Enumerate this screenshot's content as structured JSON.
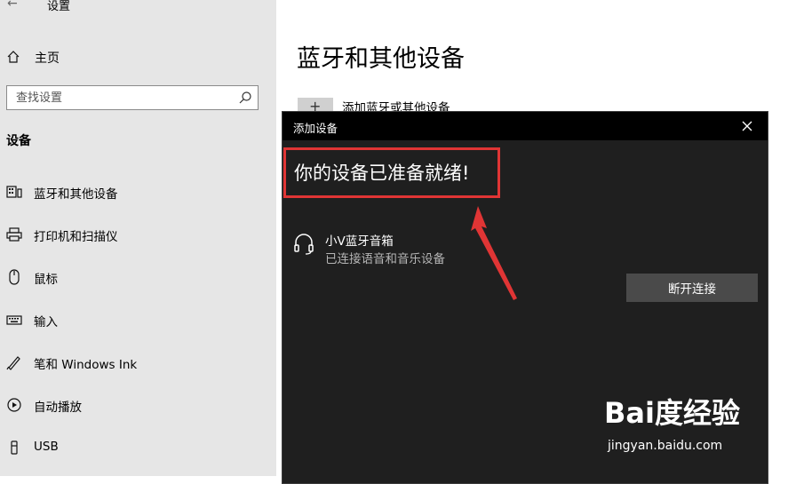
{
  "window": {
    "title": "设置",
    "back_icon": "back-arrow-icon"
  },
  "sidebar": {
    "home_label": "主页",
    "search_placeholder": "查找设置",
    "section_title": "设备",
    "items": [
      {
        "label": "蓝牙和其他设备",
        "icon": "bluetooth-devices-icon"
      },
      {
        "label": "打印机和扫描仪",
        "icon": "printer-icon"
      },
      {
        "label": "鼠标",
        "icon": "mouse-icon"
      },
      {
        "label": "输入",
        "icon": "keyboard-icon"
      },
      {
        "label": "笔和 Windows Ink",
        "icon": "pen-icon"
      },
      {
        "label": "自动播放",
        "icon": "autoplay-icon"
      },
      {
        "label": "USB",
        "icon": "usb-icon"
      }
    ]
  },
  "main": {
    "page_title": "蓝牙和其他设备",
    "add_label": "添加蓝牙或其他设备"
  },
  "dialog": {
    "title": "添加设备",
    "ready_text": "你的设备已准备就绪!",
    "device_name": "小V蓝牙音箱",
    "device_status": "已连接语音和音乐设备",
    "disconnect_label": "断开连接",
    "highlight_color": "#e03535"
  },
  "watermark": {
    "brand": "Bai度经验",
    "sub": "jingyan.baidu.com"
  }
}
